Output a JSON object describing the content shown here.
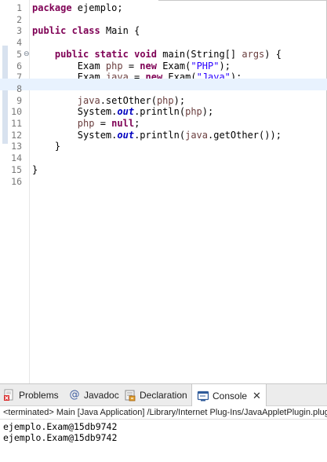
{
  "editor": {
    "lines": [
      {
        "n": "1",
        "text": "package ejemplo;"
      },
      {
        "n": "2",
        "text": ""
      },
      {
        "n": "3",
        "text": "public class Main {"
      },
      {
        "n": "4",
        "text": ""
      },
      {
        "n": "5",
        "text": "    public static void main(String[] args) {"
      },
      {
        "n": "6",
        "text": "        Exam php = new Exam(\"PHP\");"
      },
      {
        "n": "7",
        "text": "        Exam java = new Exam(\"Java\");"
      },
      {
        "n": "8",
        "text": ""
      },
      {
        "n": "9",
        "text": "        java.setOther(php);"
      },
      {
        "n": "10",
        "text": "        System.out.println(php);"
      },
      {
        "n": "11",
        "text": "        php = null;"
      },
      {
        "n": "12",
        "text": "        System.out.println(java.getOther());"
      },
      {
        "n": "13",
        "text": "    }"
      },
      {
        "n": "14",
        "text": ""
      },
      {
        "n": "15",
        "text": "}"
      },
      {
        "n": "16",
        "text": ""
      }
    ],
    "current_line": "8"
  },
  "tabs": {
    "problems": "Problems",
    "javadoc": "Javadoc",
    "declaration": "Declaration",
    "console": "Console",
    "close": "✕"
  },
  "console": {
    "status": "<terminated> Main [Java Application] /Library/Internet Plug-Ins/JavaAppletPlugin.plugin/Contents/Home/bin/java",
    "output": [
      "ejemplo.Exam@15db9742",
      "ejemplo.Exam@15db9742"
    ]
  },
  "colors": {
    "keyword": "#7f0055",
    "string": "#2a00ff",
    "local_variable": "#6a3e3e",
    "static_field": "#0000c0",
    "current_line": "#e8f2fe"
  }
}
